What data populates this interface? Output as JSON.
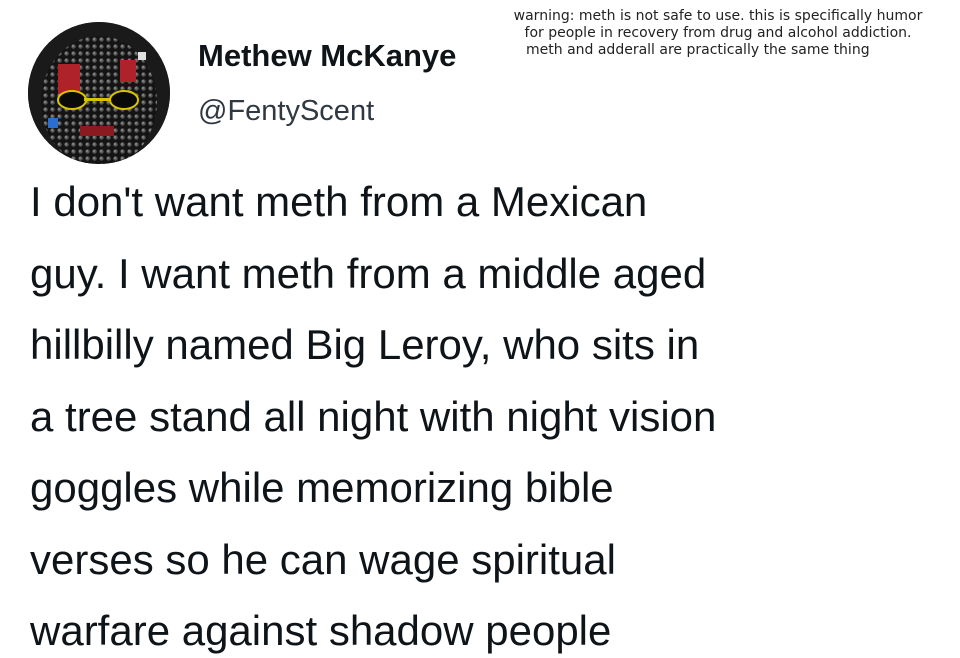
{
  "author": {
    "display_name": "Methew McKanye",
    "handle": "@FentyScent",
    "avatar_icon": "profile-avatar-icon"
  },
  "overlay_warning": {
    "lines": [
      "warning: meth is not safe to use. this is specifically humor",
      "for people in recovery from drug and alcohol addiction.",
      "meth and adderall are practically the same thing"
    ]
  },
  "tweet": {
    "lines": [
      "I don't want meth from a Mexican",
      "guy. I want meth from a middle aged",
      "hillbilly named Big Leroy, who sits in",
      "a tree stand all night with night vision",
      "goggles while memorizing bible",
      "verses so he can wage spiritual",
      "warfare against shadow people"
    ]
  },
  "colors": {
    "background": "#ffffff",
    "text_primary": "#0f1419",
    "text_secondary": "#303841"
  }
}
